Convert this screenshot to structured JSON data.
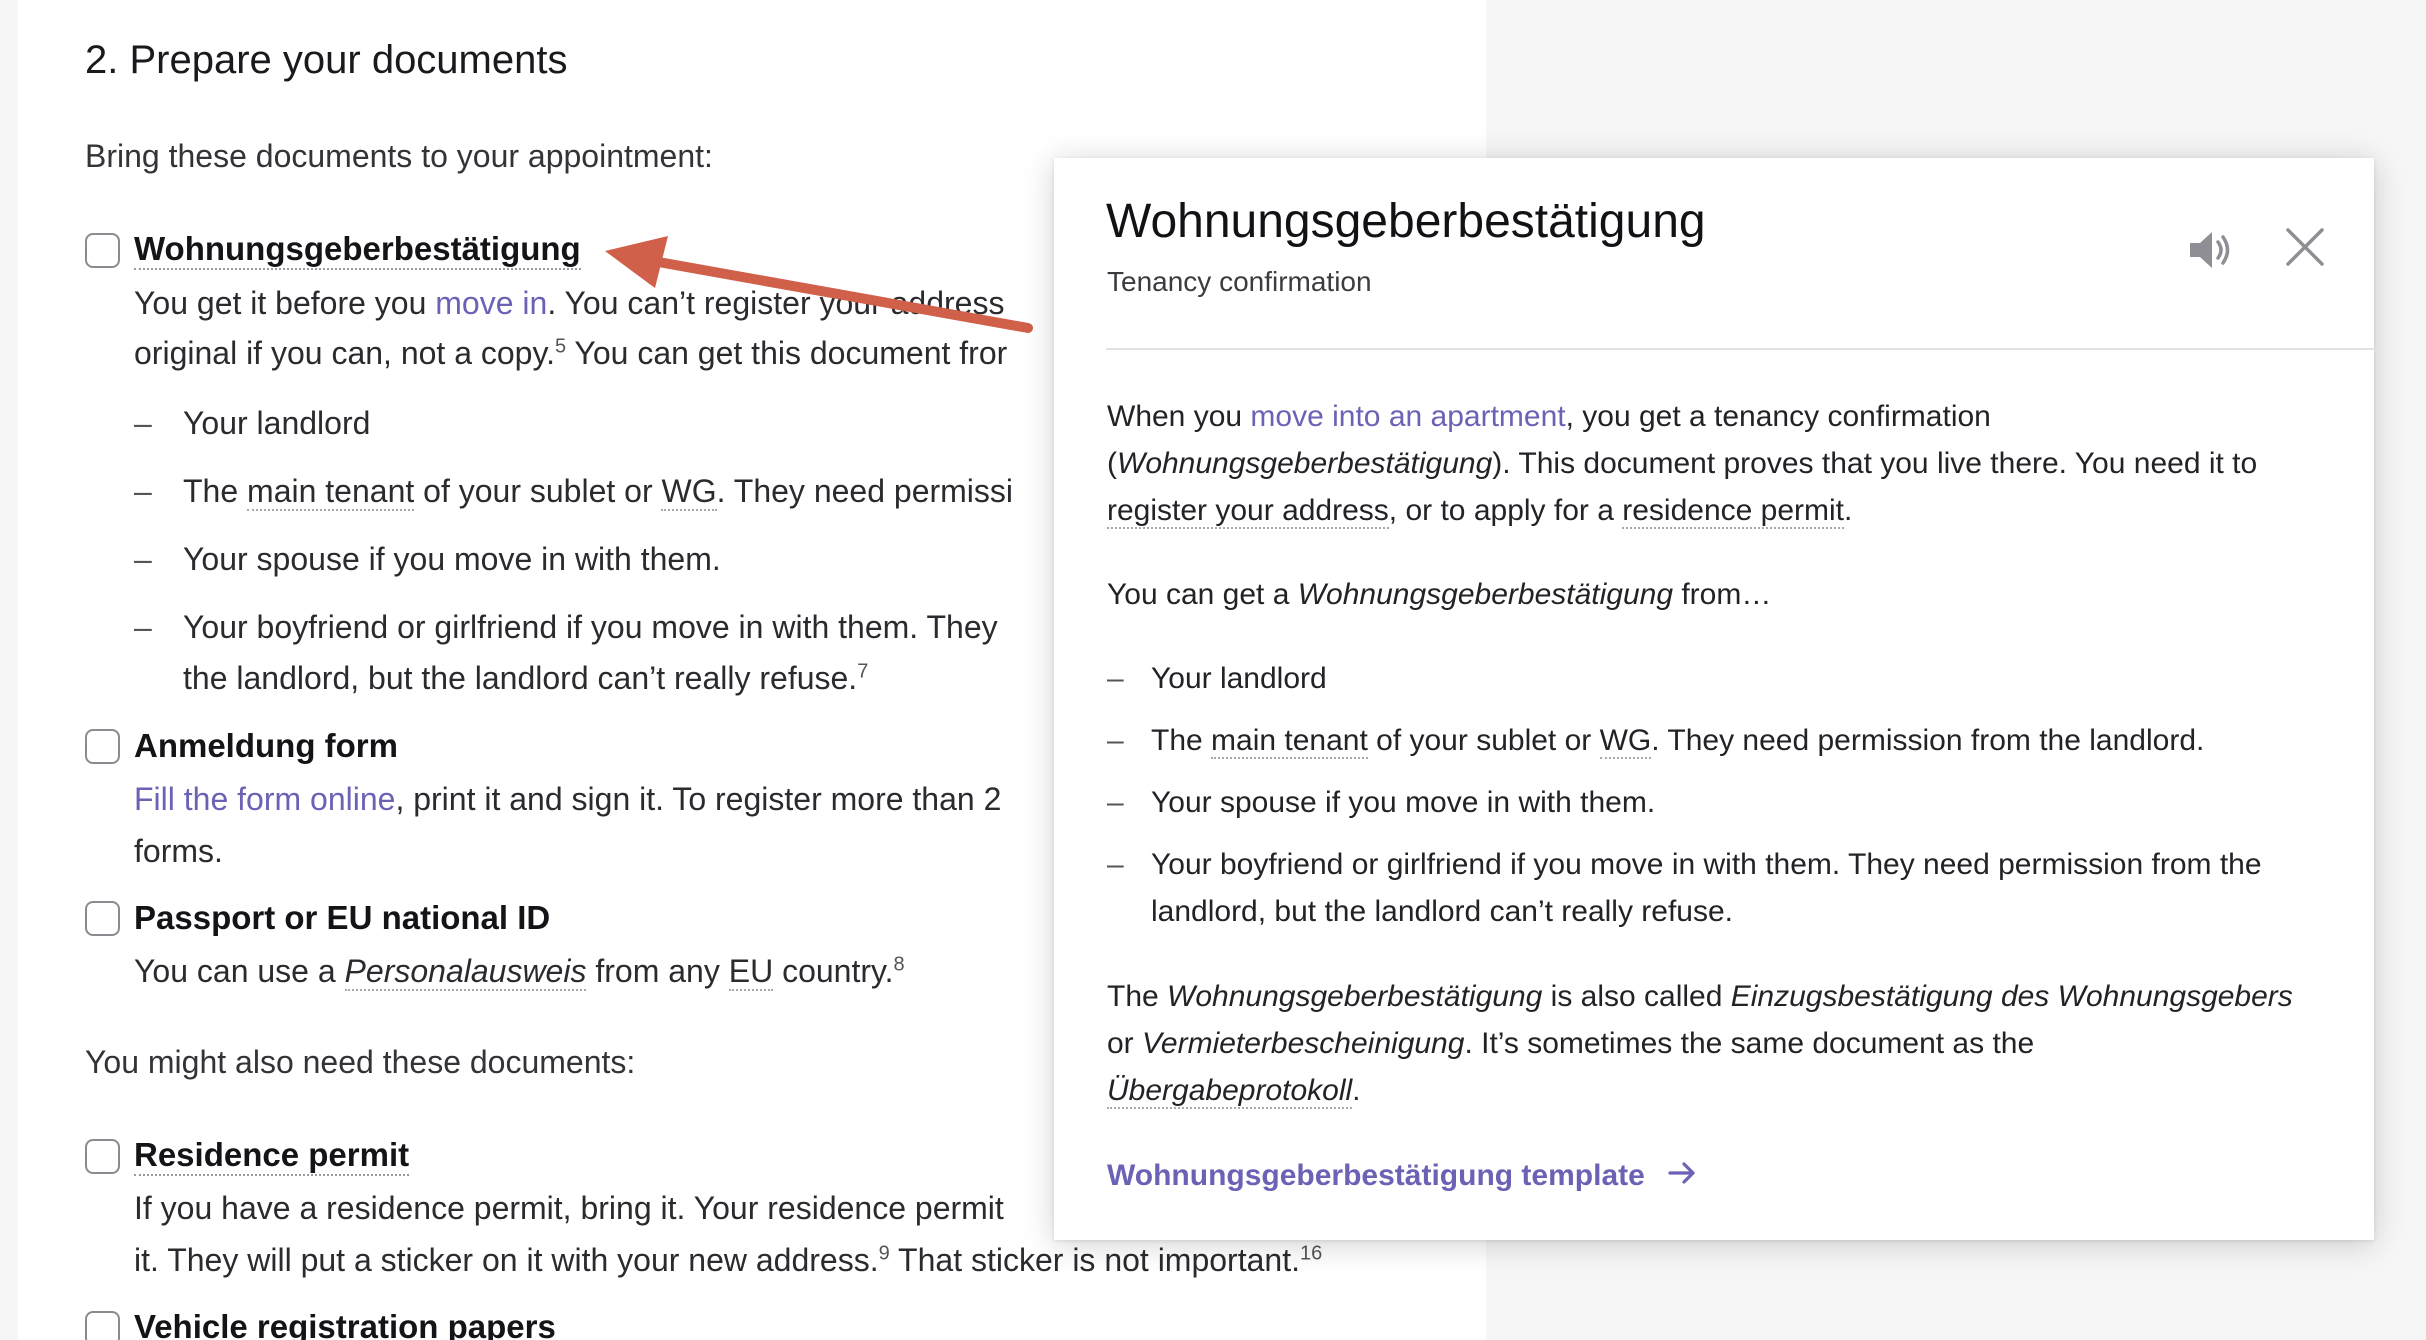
{
  "article": {
    "section_title": "2. Prepare your documents",
    "intro_required": "Bring these documents to your appointment:",
    "intro_optional": "You might also need these documents:",
    "items": [
      {
        "title": "Wohnungsgeberbestätigung",
        "line1_pre": "You get it before you ",
        "line1_link": "move in",
        "line1_post": ". You can’t register your address ",
        "line2_pre": "original if you can, not a copy.",
        "line2_fn": "5",
        "line2_post": " You can get this document fror",
        "bullets": [
          {
            "pre": "Your landlord",
            "dotted": "",
            "mid": "",
            "dotted2": "",
            "post": ""
          },
          {
            "pre": "The ",
            "dotted": "main tenant",
            "mid": " of your sublet or ",
            "dotted2": "WG",
            "post": ". They need permissi"
          },
          {
            "pre": "Your spouse if you move in with them.",
            "dotted": "",
            "mid": "",
            "dotted2": "",
            "post": ""
          },
          {
            "pre": "Your boyfriend or girlfriend if you move in with them. They",
            "dotted": "",
            "mid": "",
            "dotted2": "",
            "post": ""
          }
        ],
        "bullet4_line2": "the landlord, but the landlord can’t really refuse.",
        "bullet4_fn": "7"
      },
      {
        "title": "Anmeldung form",
        "link": "Fill the form online",
        "line1_post": ", print it and sign it. To register more than 2",
        "line2": "forms."
      },
      {
        "title": "Passport or EU national ID",
        "line1_pre": "You can use a ",
        "line1_italic": "Personalausweis",
        "line1_mid": " from any ",
        "line1_dotted": "EU",
        "line1_post": " country.",
        "line1_fn": "8"
      },
      {
        "title": "Residence permit",
        "line1": "If you have a residence permit, bring it. Your residence permit",
        "line2_pre": "it. They will put a sticker on it with your new address.",
        "line2_fn1": "9",
        "line2_post": " That sticker is not important.",
        "line2_fn2": "16"
      },
      {
        "title": "Vehicle registration papers"
      }
    ]
  },
  "popup": {
    "title": "Wohnungsgeberbestätigung",
    "subtitle": "Tenancy confirmation",
    "speaker_icon": "speaker-icon",
    "close_icon": "close-icon",
    "p1_l1_pre": "When you ",
    "p1_l1_link": "move into an apartment",
    "p1_l1_post": ", you get a tenancy confirmation",
    "p1_l2_pre": "(",
    "p1_l2_italic": "Wohnungsgeberbestätigung",
    "p1_l2_post": "). This document proves that you live there. You need it to",
    "p1_l3_dotted1": "register your address",
    "p1_l3_mid": ", or to apply for a ",
    "p1_l3_dotted2": "residence permit",
    "p1_l3_post": ".",
    "p2_pre": "You can get a ",
    "p2_italic": "Wohnungsgeberbestätigung",
    "p2_post": " from…",
    "bullets": {
      "b1": "Your landlord",
      "b2_pre": "The ",
      "b2_dotted": "main tenant",
      "b2_mid": " of your sublet or ",
      "b2_dotted2": "WG",
      "b2_post": ". They need permission from the landlord.",
      "b3": "Your spouse if you move in with them.",
      "b4_l1": "Your boyfriend or girlfriend if you move in with them. They need permission from the",
      "b4_l2": "landlord, but the landlord can’t really refuse."
    },
    "p3_l1_pre": "The ",
    "p3_l1_italic1": "Wohnungsgeberbestätigung",
    "p3_l1_mid": " is also called ",
    "p3_l1_italic2": "Einzugsbestätigung des Wohnungsgebers",
    "p3_l2_pre": "or ",
    "p3_l2_italic": "Vermieterbescheinigung",
    "p3_l2_post": ". It’s sometimes the same document as the",
    "p3_l3_italic": "Übergabeprotokoll",
    "p3_l3_post": ".",
    "template_link": "Wohnungsgeberbestätigung template"
  },
  "colors": {
    "link": "#6a62b5",
    "arrow": "#d0604a",
    "background": "#f6f6f7"
  }
}
